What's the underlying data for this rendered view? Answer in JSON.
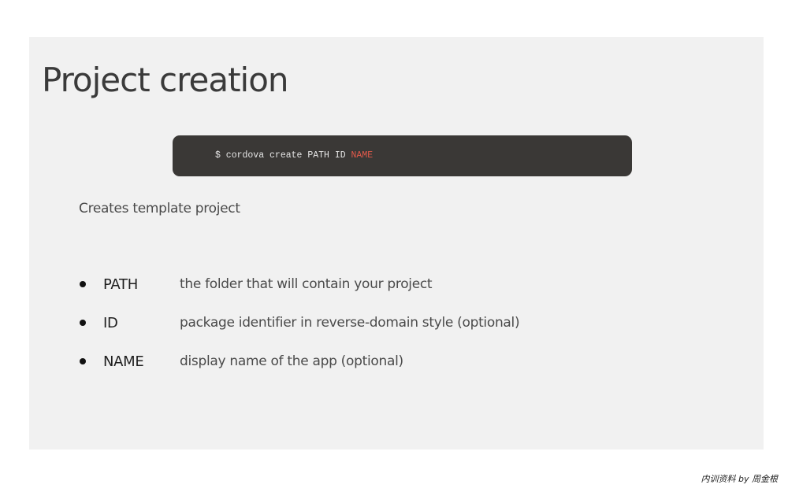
{
  "slide": {
    "title": "Project creation",
    "command": {
      "prompt": "$ cordova create PATH ID ",
      "highlighted_arg": "NAME",
      "highlight_color": "#e2594a"
    },
    "description": "Creates template project",
    "params": [
      {
        "name": "PATH",
        "desc": "the folder that will contain your project"
      },
      {
        "name": "ID",
        "desc": "package identifier in reverse-domain style (optional)"
      },
      {
        "name": "NAME",
        "desc": "display name of the app (optional)"
      }
    ]
  },
  "footer": {
    "credit": "内训资料 by 周金根"
  },
  "colors": {
    "slide_background": "#f1f1f1",
    "code_background": "#3a3836"
  }
}
